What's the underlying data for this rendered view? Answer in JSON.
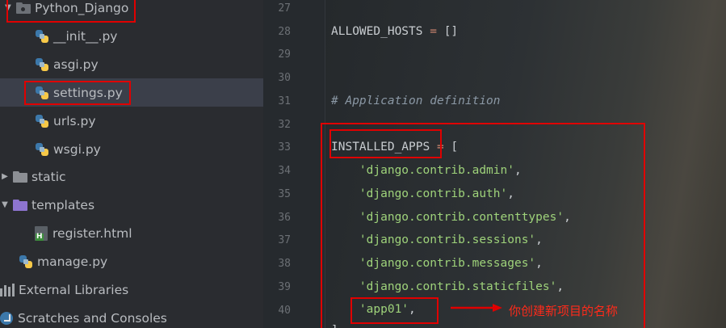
{
  "project_tree": {
    "root_folder": "Python_Django",
    "files": [
      {
        "name": "__init__.py",
        "type": "python"
      },
      {
        "name": "asgi.py",
        "type": "python"
      },
      {
        "name": "settings.py",
        "type": "python",
        "selected": true
      },
      {
        "name": "urls.py",
        "type": "python"
      },
      {
        "name": "wsgi.py",
        "type": "python"
      }
    ],
    "folder_static": "static",
    "folder_templates": "templates",
    "template_file": "register.html",
    "manage_file": "manage.py",
    "external_libraries": "External Libraries",
    "scratches": "Scratches and Consoles"
  },
  "editor": {
    "line_numbers": [
      "27",
      "28",
      "29",
      "30",
      "31",
      "32",
      "33",
      "34",
      "35",
      "36",
      "37",
      "38",
      "39",
      "40"
    ],
    "lines": {
      "l28_name": "ALLOWED_HOSTS",
      "l28_eq": " = ",
      "l28_val": "[]",
      "l31_comment": "# Application definition",
      "l33_name": "INSTALLED_APPS",
      "l33_eq": " = ",
      "l33_val": "[",
      "apps": [
        "'django.contrib.admin'",
        "'django.contrib.auth'",
        "'django.contrib.contenttypes'",
        "'django.contrib.sessions'",
        "'django.contrib.messages'",
        "'django.contrib.staticfiles'",
        "'app01'"
      ],
      "comma": ",",
      "l41_close": "]"
    }
  },
  "annotation": {
    "note": "你创建新项目的名称",
    "color": "#e00000"
  },
  "colors": {
    "string": "#9ed27a",
    "operator": "#d08770",
    "comment": "#8b98a5",
    "selection": "#3b3f4a"
  }
}
